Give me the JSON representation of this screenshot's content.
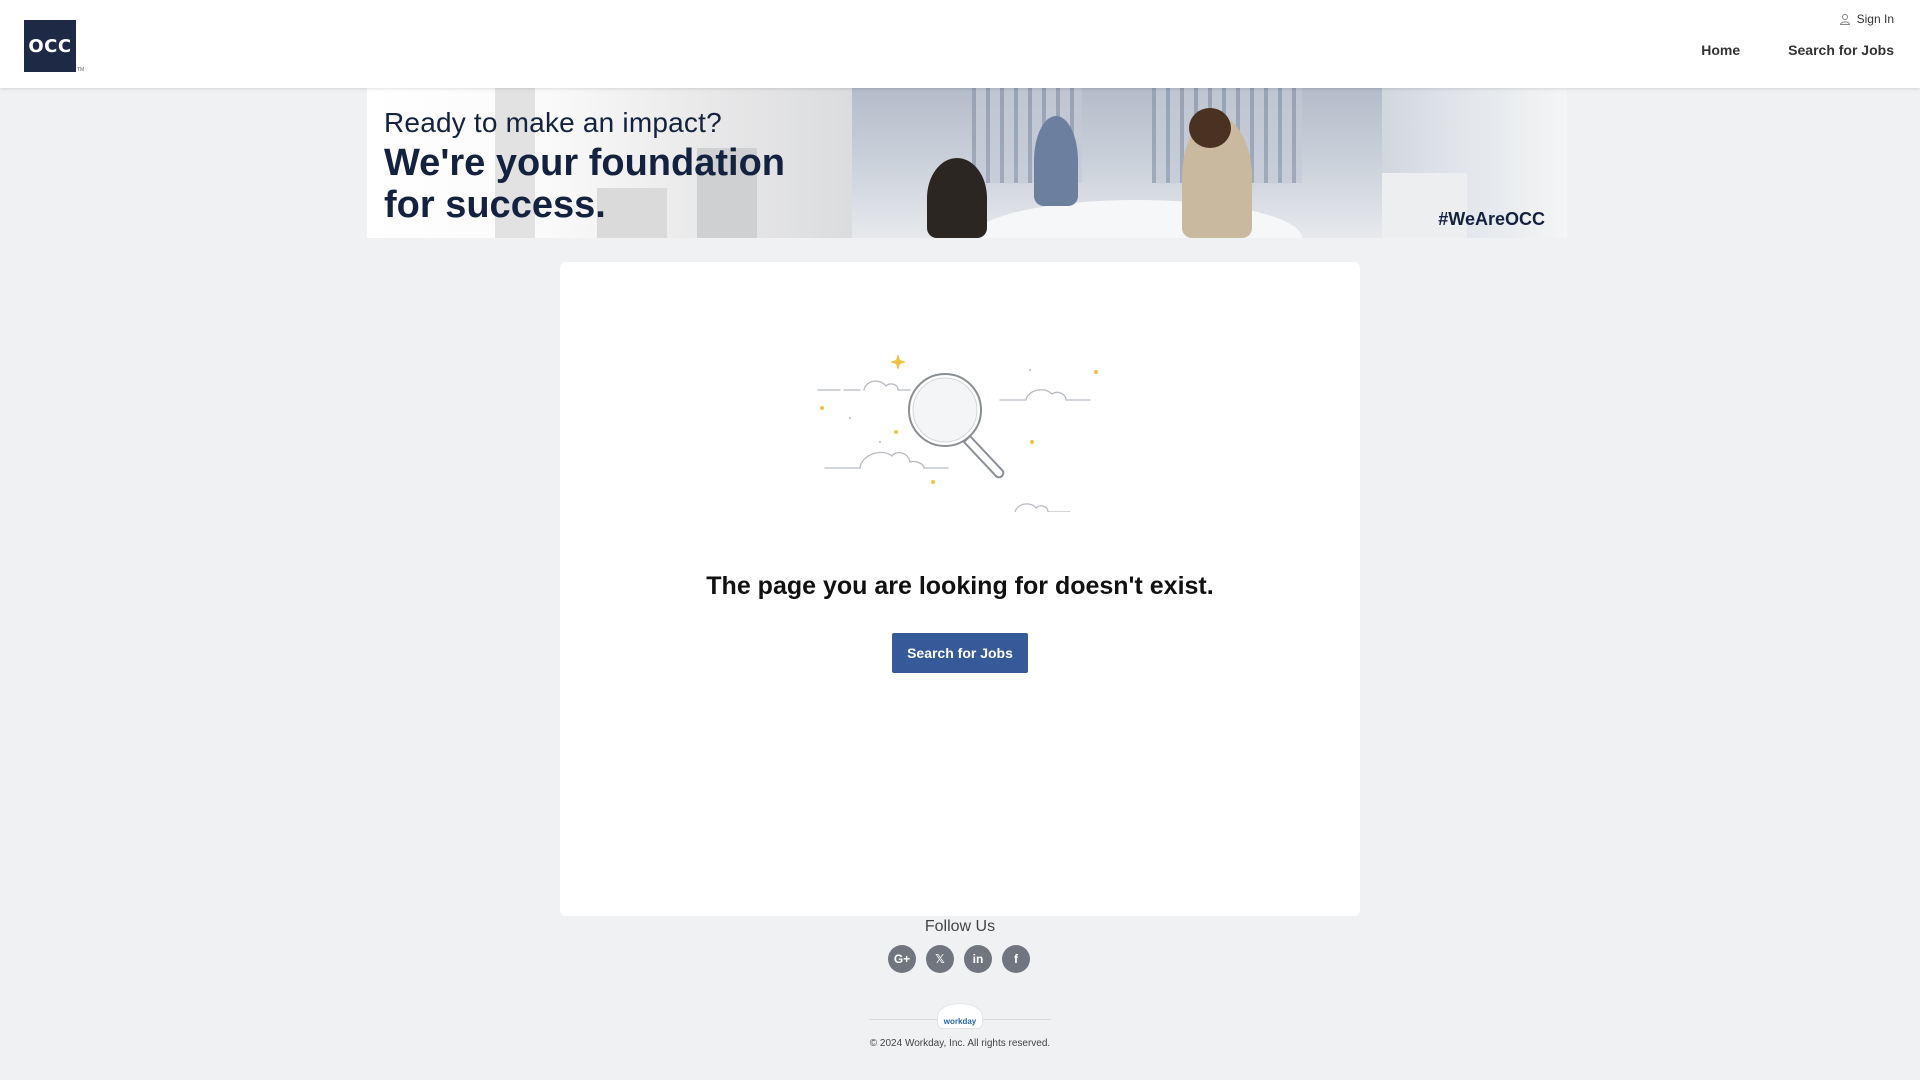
{
  "header": {
    "logo_text": "OCC",
    "logo_trademark": "TM",
    "sign_in_label": "Sign In",
    "nav": [
      {
        "label": "Home"
      },
      {
        "label": "Search for Jobs"
      }
    ]
  },
  "banner": {
    "line1": "Ready to make an impact?",
    "line2a": "We're your foundation",
    "line2b": "for success.",
    "hashtag": "#WeAreOCC"
  },
  "main": {
    "error_message": "The page you are looking for doesn't exist.",
    "search_button_label": "Search for Jobs"
  },
  "footer": {
    "follow_label": "Follow Us",
    "social": [
      {
        "icon": "google-plus-icon",
        "glyph": "G+"
      },
      {
        "icon": "x-twitter-icon",
        "glyph": "𝕏"
      },
      {
        "icon": "linkedin-icon",
        "glyph": "in"
      },
      {
        "icon": "facebook-icon",
        "glyph": "f"
      }
    ],
    "brand": "workday",
    "copyright": "© 2024 Workday, Inc. All rights reserved."
  },
  "colors": {
    "primary_button": "#365a99",
    "logo_background": "#1e2a45",
    "banner_text": "#13233f",
    "page_background": "#f0f1f2"
  }
}
